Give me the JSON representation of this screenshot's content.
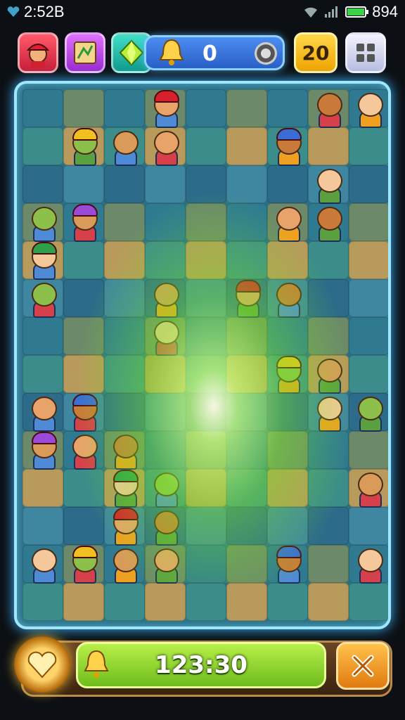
{
  "status_bar": {
    "time": "2:52B",
    "battery_level": "894"
  },
  "hud": {
    "score": "0",
    "level": "20",
    "icons": [
      "avatar-icon",
      "map-icon",
      "gem-icon",
      "bell-icon",
      "coin-icon",
      "grid-icon"
    ]
  },
  "timer": {
    "value": "123:30"
  },
  "colors": {
    "board_border": "#9fe6ff",
    "glow": "#a6ff3a",
    "level_badge": "#ffd84a",
    "timer_bar": "#8fd42c",
    "close_button": "#f39a24"
  }
}
